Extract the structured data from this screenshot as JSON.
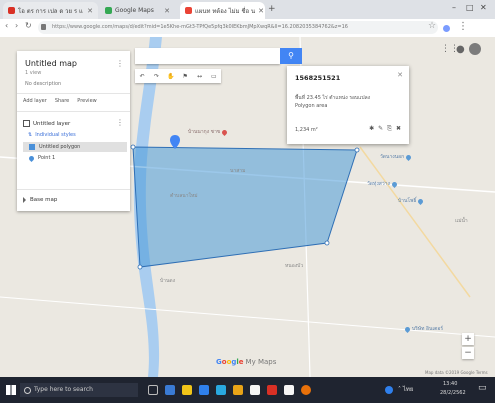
{
  "browser": {
    "tabs": [
      {
        "label": "โอ ตร การ เปล ด วย ร แ",
        "favicon_color": "#d93025"
      },
      {
        "label": "Google Maps",
        "favicon_color": "#34a853"
      },
      {
        "label": "แผนท ทต้อง ไม่ม ชื่อ น",
        "favicon_color": "#ea4335"
      }
    ],
    "new_tab": "+",
    "url": "https://www.google.com/maps/d/edit?mid=1e5Khe-mGt3-TPfQe5pfq3k0lEKbmJMpXwqR&ll=16.2082035384762&z=16",
    "window_controls": [
      "–",
      "□",
      "✕"
    ]
  },
  "map": {
    "search_icon": "search-icon",
    "toolbar": [
      "↶",
      "↷",
      "✋",
      "⚑",
      "↔",
      "▭"
    ],
    "places": [
      {
        "label": "บ้านนากุง ชาข",
        "color": "#d9534f"
      },
      {
        "label": "วัดนางนอก",
        "color": "#5b9bd5"
      },
      {
        "label": "วัดทุ่งสว่าง",
        "color": "#5b9bd5"
      },
      {
        "label": "บ้านโพธิ์",
        "color": "#5b9bd5"
      },
      {
        "label": "บริษัท อินเตอร์",
        "color": "#5b9bd5"
      }
    ],
    "area_labels": [
      "ตำบลนาใหม่",
      "นาสาม",
      "หนองบัว",
      "บ้านดง",
      "แม่น้ำ"
    ],
    "zoom_in": "+",
    "zoom_out": "−",
    "brand": [
      "G",
      "o",
      "o",
      "g",
      "l",
      "e"
    ],
    "brand_suffix": "My Maps",
    "copyright": "Map data ©2019 Google  Terms"
  },
  "sidebar": {
    "title": "Untitled map",
    "subtitle": "1 view",
    "description": "No description",
    "actions": [
      "Add layer",
      "Share",
      "Preview"
    ],
    "layer_name": "Untitled layer",
    "layer_link": "Individual styles",
    "items": [
      "Untitled polygon",
      "Point 1"
    ],
    "base_map": "Base map"
  },
  "popup": {
    "title": "1568251521",
    "lines": [
      "พื้นที่ 23.45 ไร่ ตำแหน่ง รอบแปลง",
      "Polygon area"
    ],
    "measure": "1,234 m²",
    "tools": [
      "✱",
      "✎",
      "⎘",
      "✖"
    ]
  },
  "taskbar": {
    "search_placeholder": "Type here to search",
    "apps": [
      "#3a7bd5",
      "#f0c419",
      "#2f80ed",
      "#29a8e0",
      "#e8a317",
      "#d93025",
      "#f5f5f5",
      "#e8710a"
    ],
    "tray_text": "˄  ไทย",
    "time": "13:40",
    "date": "28/2/2562"
  }
}
